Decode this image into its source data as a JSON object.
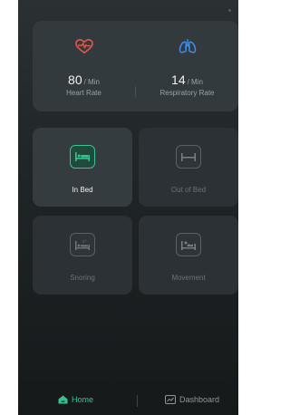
{
  "vitals": {
    "heart_rate": {
      "value": "80",
      "unit": "/ Min",
      "label": "Heart Rate",
      "icon": "heart-pulse-icon",
      "color": "#e2574c"
    },
    "respiratory_rate": {
      "value": "14",
      "unit": "/ Min",
      "label": "Respiratory Rate",
      "icon": "lungs-icon",
      "color": "#3f8ef0"
    }
  },
  "status_tiles": [
    {
      "label": "In Bed",
      "icon": "in-bed-icon",
      "active": true
    },
    {
      "label": "Out of Bed",
      "icon": "out-of-bed-icon",
      "active": false
    },
    {
      "label": "Snoring",
      "icon": "snoring-icon",
      "active": false
    },
    {
      "label": "Movement",
      "icon": "movement-icon",
      "active": false
    }
  ],
  "nav": {
    "home_label": "Home",
    "dashboard_label": "Dashboard",
    "active_color": "#34c38f"
  }
}
